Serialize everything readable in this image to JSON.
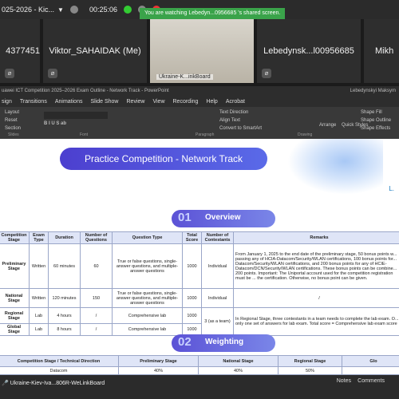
{
  "topbar": {
    "title": "025-2026 - Kic...",
    "timer": "00:25:06"
  },
  "toast": "You are watching Lebedyn...0956685 's shared screen.",
  "tiles": [
    {
      "name": "4377451",
      "video": false
    },
    {
      "name": "Viktor_SAHAIDAK (Me)",
      "video": false
    },
    {
      "name": "Ukraine-K...inkBoard",
      "video": true
    },
    {
      "name": "Lebedynsk...l00956685",
      "video": false
    },
    {
      "name": "Mikh",
      "video": false
    }
  ],
  "ppt": {
    "title": "uawei ICT Competition 2025–2026 Exam Outline - Network Track - PowerPoint",
    "user": "Lebedynskyi Maksym"
  },
  "menu": [
    "sign",
    "Transitions",
    "Animations",
    "Slide Show",
    "Review",
    "View",
    "Recording",
    "Help",
    "Acrobat"
  ],
  "ribbon": {
    "layout": "Layout",
    "reset": "Reset",
    "section": "Section",
    "slides": "Slides",
    "font": "Font",
    "paragraph": "Paragraph",
    "drawing": "Drawing",
    "arrange": "Arrange",
    "quick": "Quick Styles",
    "shape_fill": "Shape Fill",
    "shape_outline": "Shape Outline",
    "shape_effects": "Shape Effects",
    "text_direction": "Text Direction",
    "align_text": "Align Text",
    "smartart": "Convert to SmartArt"
  },
  "slide": {
    "banner": "Practice Competition - Network Track",
    "s1_num": "01",
    "s1_label": "Overview",
    "s2_num": "02",
    "s2_label": "Weighting",
    "l_letter": "L.",
    "overview_headers": [
      "Competition Stage",
      "Exam Type",
      "Duration",
      "Number of Questions",
      "Question Type",
      "Total Score",
      "Number of Contestants",
      "Remarks"
    ],
    "overview_rows": [
      [
        "Preliminary Stage",
        "Written",
        "60 minutes",
        "60",
        "True or false questions, single-answer questions, and multiple-answer questions",
        "1000",
        "Individual",
        "From January 1, 2025 to the end date of the preliminary stage, 50 bonus points w... passing any of HCIA-Datacom/Security/WLAN certifications, 100 bonus points for... Datacom/Security/WLAN certifications, and 200 bonus points for any of HCIE-Datacom/DCN/Security/WLAN certifications. These bonus points can be combine... 200 points. Important: The Uniportal account used for the competition registration must be ... the certification. Otherwise, no bonus point can be given."
      ],
      [
        "National Stage",
        "Written",
        "120 minutes",
        "150",
        "True or false questions, single-answer questions, and multiple-answer questions",
        "1000",
        "Individual",
        "/"
      ],
      [
        "Regional Stage",
        "Lab",
        "4 hours",
        "/",
        "Comprehensive lab",
        "1000",
        "3 (as a team)",
        "In Regional Stage, three contestants in a team needs to complete the lab exam. O... only one set of answers for lab exam. Total score = Comprehensive lab exam score"
      ],
      [
        "Global Stage",
        "Lab",
        "8 hours",
        "/",
        "Comprehensive lab",
        "1000",
        "",
        ""
      ]
    ],
    "weight_headers": [
      "Competition Stage / Technical Direction",
      "Preliminary Stage",
      "National Stage",
      "Regional Stage",
      "Glo"
    ],
    "weight_rows": [
      [
        "Datacom",
        "40%",
        "40%",
        "50%",
        ""
      ]
    ]
  },
  "taskbar": {
    "label": "Ukraine-Kiev-Iva...806R-WeLinkBoard",
    "notes": "Notes",
    "comments": "Comments"
  }
}
